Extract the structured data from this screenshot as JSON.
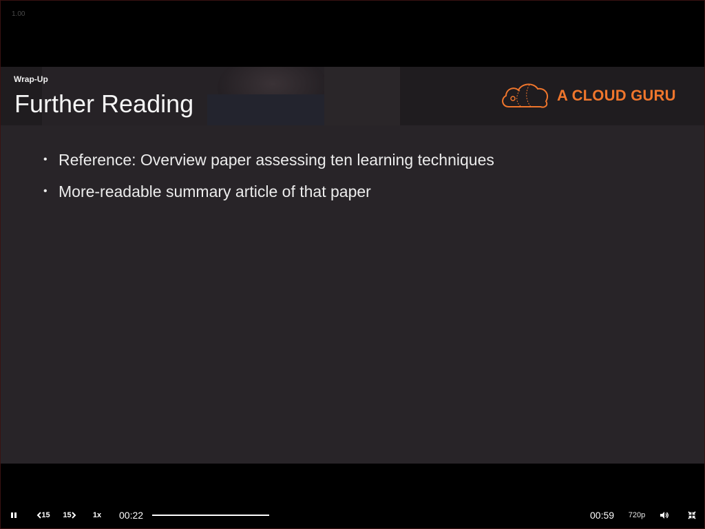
{
  "player": {
    "speed_overlay": "1.00"
  },
  "slide": {
    "section": "Wrap-Up",
    "title": "Further Reading",
    "brand": {
      "name": "A CLOUD GURU",
      "color": "#f0762c"
    },
    "bullets": [
      "Reference: Overview paper assessing ten learning techniques",
      "More-readable summary article of that paper"
    ]
  },
  "controls": {
    "play_pause_icon": "pause-icon",
    "rewind_label": "15",
    "forward_label": "15",
    "speed_label": "1x",
    "current_time": "00:22",
    "duration": "00:59",
    "progress_fraction": 1.0,
    "quality_label": "720p",
    "volume_icon": "volume-icon",
    "fullscreen_icon": "exit-fullscreen-icon"
  }
}
